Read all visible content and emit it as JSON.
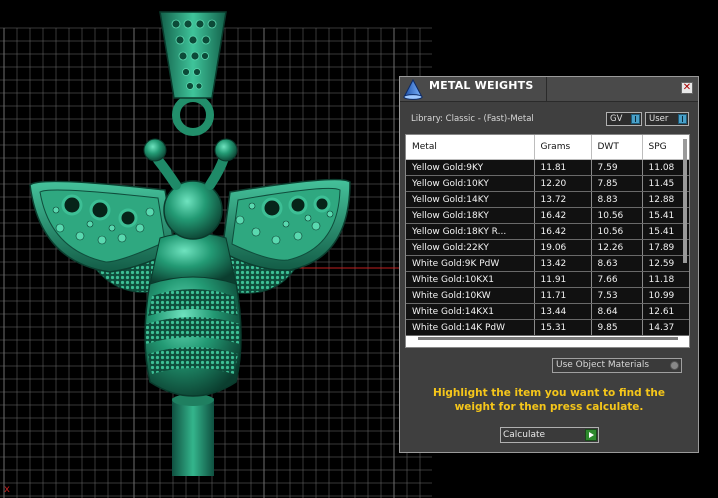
{
  "viewport": {
    "axis_label": "x"
  },
  "panel": {
    "title": "METAL WEIGHTS",
    "close_glyph": "✕",
    "library_label": "Library: Classic - (Fast)-Metal",
    "gv_button": "GV",
    "user_button": "User",
    "table": {
      "columns": [
        "Metal",
        "Grams",
        "DWT",
        "SPG"
      ],
      "rows": [
        [
          "Yellow Gold:9KY",
          "11.81",
          "7.59",
          "11.08"
        ],
        [
          "Yellow Gold:10KY",
          "12.20",
          "7.85",
          "11.45"
        ],
        [
          "Yellow Gold:14KY",
          "13.72",
          "8.83",
          "12.88"
        ],
        [
          "Yellow Gold:18KY",
          "16.42",
          "10.56",
          "15.41"
        ],
        [
          "Yellow Gold:18KY R...",
          "16.42",
          "10.56",
          "15.41"
        ],
        [
          "Yellow Gold:22KY",
          "19.06",
          "12.26",
          "17.89"
        ],
        [
          "White Gold:9K PdW",
          "13.42",
          "8.63",
          "12.59"
        ],
        [
          "White Gold:10KX1",
          "11.91",
          "7.66",
          "11.18"
        ],
        [
          "White Gold:10KW",
          "11.71",
          "7.53",
          "10.99"
        ],
        [
          "White Gold:14KX1",
          "13.44",
          "8.64",
          "12.61"
        ],
        [
          "White Gold:14K PdW",
          "15.31",
          "9.85",
          "14.37"
        ]
      ]
    },
    "use_object_materials": "Use Object Materials",
    "instructions": "Highlight the item you want to find the weight for then press calculate.",
    "calculate_button": "Calculate"
  },
  "colors": {
    "background": "#000000",
    "grid": "#6e6e6e",
    "pendant": "#1f8a68",
    "instruction_text": "#f5c61a",
    "panel": "#3f3f3f"
  },
  "icons": {
    "title": "pyramid-cone-icon",
    "close": "close-icon",
    "toggle": "slider-knob-icon",
    "calculate": "play-arrow-icon"
  }
}
